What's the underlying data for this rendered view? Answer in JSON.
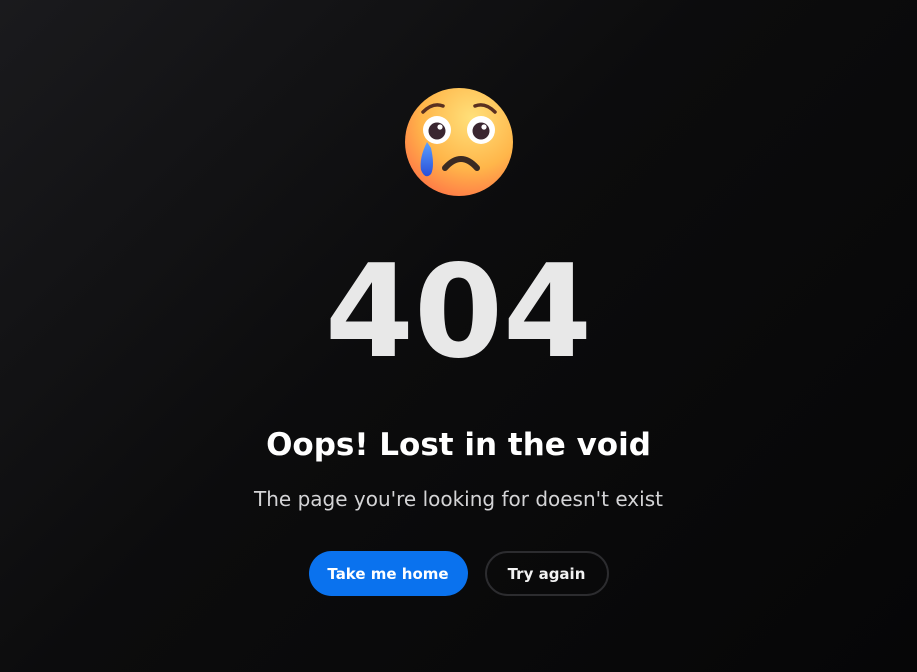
{
  "emoji": {
    "icon": "crying-face-icon",
    "colors": {
      "face_light": "#ffd36a",
      "face_dark": "#ff7a3d",
      "tear": "#2f6ef0",
      "mouth": "#3a2a22"
    }
  },
  "error": {
    "code": "404",
    "headline": "Oops! Lost in the void",
    "message": "The page you're looking for doesn't exist"
  },
  "actions": {
    "primary_label": "Take me home",
    "secondary_label": "Try again"
  },
  "theme": {
    "background": "#0c0c0d",
    "accent": "#0a72ee",
    "code_color": "#e8e8e8"
  }
}
